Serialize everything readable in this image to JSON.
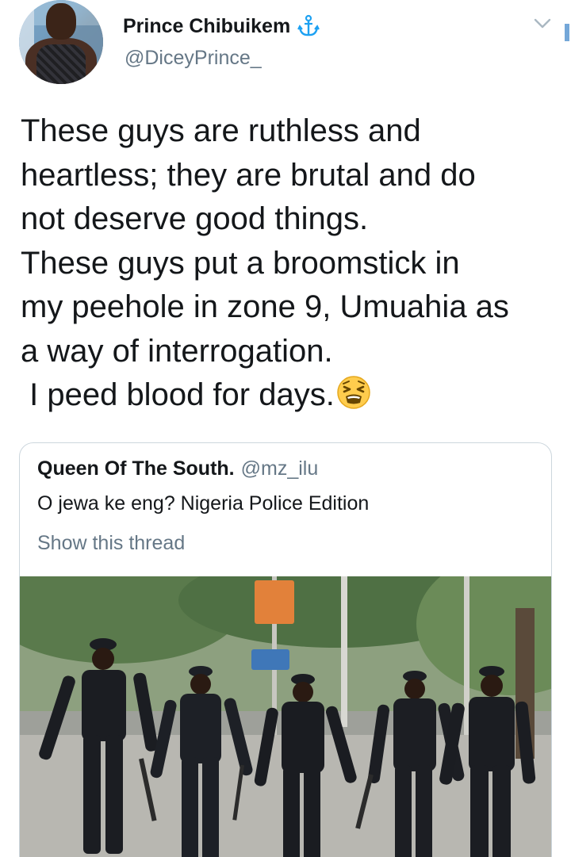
{
  "author": {
    "display_name": "Prince Chibuikem",
    "handle": "@DiceyPrince_",
    "badge_icon": "anchor-icon",
    "avatar_icon": "profile-avatar"
  },
  "tweet": {
    "lines": [
      "These guys are ruthless and",
      "heartless; they are brutal and do",
      "not deserve good things.",
      "These guys put a broomstick in",
      "my peehole in zone 9, Umuahia as",
      "a way of interrogation.",
      " I peed blood for days."
    ],
    "trailing_emoji": "tired-face-emoji"
  },
  "quoted_tweet": {
    "display_name": "Queen Of The South.",
    "handle": "@mz_ilu",
    "text": "O jewa ke eng? Nigeria Police Edition",
    "show_thread_label": "Show this thread",
    "media_icon": "photo-police-officers"
  },
  "colors": {
    "text_primary": "#14171a",
    "text_secondary": "#657786",
    "border": "#ccd6dd",
    "accent": "#1da1f2"
  }
}
